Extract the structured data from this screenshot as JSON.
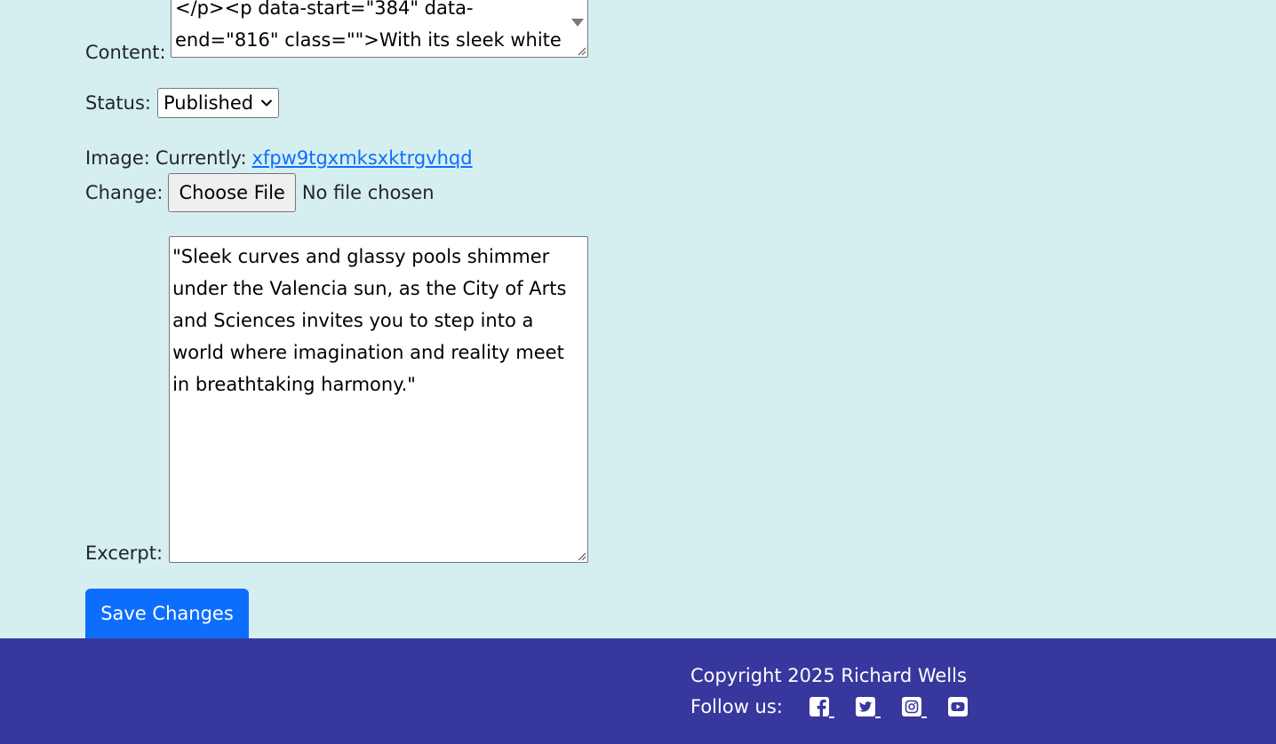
{
  "form": {
    "content_label": "Content:",
    "content_value": "</p><p data-start=\"384\" data-end=\"816\" class=\"\">With its sleek white",
    "status_label": "Status:",
    "status_selected": "Published",
    "image_label": "Image:",
    "currently_label": "Currently:",
    "image_link_text": "xfpw9tgxmksxktrgvhqd",
    "change_label": "Change:",
    "choose_file_label": "Choose File",
    "file_status": "No file chosen",
    "excerpt_label": "Excerpt:",
    "excerpt_value": "\"Sleek curves and glassy pools shimmer under the Valencia sun, as the City of Arts and Sciences invites you to step into a world where imagination and reality meet in breathtaking harmony.\"",
    "save_label": "Save Changes"
  },
  "footer": {
    "copyright": "Copyright 2025 Richard Wells",
    "follow_label": "Follow us:",
    "social_icons": [
      "facebook-icon",
      "twitter-icon",
      "instagram-icon",
      "youtube-icon"
    ]
  },
  "colors": {
    "page_bg": "#d5eff1",
    "footer_bg": "#38379e",
    "primary": "#0d6efd",
    "link": "#0d6efd"
  }
}
